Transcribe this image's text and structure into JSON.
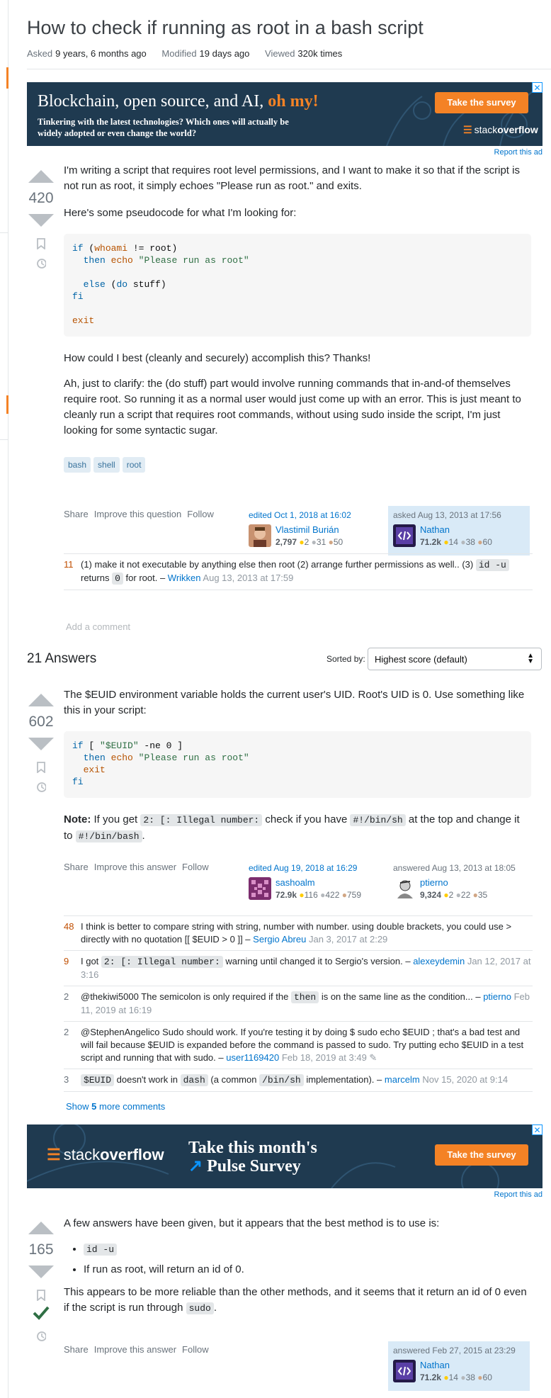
{
  "question": {
    "title": "How to check if running as root in a bash script",
    "asked_label": "Asked",
    "asked": "9 years, 6 months ago",
    "modified_label": "Modified",
    "modified": "19 days ago",
    "viewed_label": "Viewed",
    "viewed": "320k times",
    "score": "420",
    "p1": "I'm writing a script that requires root level permissions, and I want to make it so that if the script is not run as root, it simply echoes \"Please run as root.\" and exits.",
    "p2": "Here's some pseudocode for what I'm looking for:",
    "p3": "How could I best (cleanly and securely) accomplish this? Thanks!",
    "p4": "Ah, just to clarify: the (do stuff) part would involve running commands that in-and-of themselves require root. So running it as a normal user would just come up with an error. This is just meant to cleanly run a script that requires root commands, without using sudo inside the script, I'm just looking for some syntactic sugar.",
    "tags": [
      "bash",
      "shell",
      "root"
    ],
    "actions": [
      "Share",
      "Improve this question",
      "Follow"
    ],
    "edited": {
      "label": "edited Oct 1, 2018 at 16:02",
      "name": "Vlastimil Burián",
      "rep": "2,797",
      "gold": "2",
      "silver": "31",
      "bronze": "50"
    },
    "asked_by": {
      "label": "asked Aug 13, 2013 at 17:56",
      "name": "Nathan",
      "rep": "71.2k",
      "gold": "14",
      "silver": "38",
      "bronze": "60"
    },
    "comment": {
      "score": "11",
      "text_a": "(1) make it not executable by anything else then root (2) arrange further permissions as well.. (3)",
      "code1": "id -u",
      "text_b": "returns",
      "code2": "0",
      "text_c": "for root. –",
      "user": "Wrikken",
      "date": "Aug 13, 2013 at 17:59"
    },
    "add_comment": "Add a comment"
  },
  "ad1": {
    "headline": "Blockchain, open source, and AI,",
    "headline_accent": "oh my!",
    "sub": "Tinkering with the latest technologies? Which ones will actually be widely adopted or even change the world?",
    "button": "Take the survey",
    "logo_a": "stack",
    "logo_b": "overflow",
    "close": "✕"
  },
  "report_ad": "Report this ad",
  "answers_header": {
    "count": "21 Answers",
    "sort_label": "Sorted by:",
    "sort_value": "Highest score (default)"
  },
  "answer1": {
    "score": "602",
    "p1": "The $EUID environment variable holds the current user's UID. Root's UID is 0. Use something like this in your script:",
    "note_label": "Note:",
    "note_a": "If you get",
    "note_code1": "2: [: Illegal number:",
    "note_b": "check if you have",
    "note_code2": "#!/bin/sh",
    "note_c": "at the top and change it to",
    "note_code3": "#!/bin/bash",
    "note_d": ".",
    "actions": [
      "Share",
      "Improve this answer",
      "Follow"
    ],
    "edited": {
      "label": "edited Aug 19, 2018 at 16:29",
      "name": "sashoalm",
      "rep": "72.9k",
      "gold": "116",
      "silver": "422",
      "bronze": "759"
    },
    "answered": {
      "label": "answered Aug 13, 2013 at 18:05",
      "name": "ptierno",
      "rep": "9,324",
      "gold": "2",
      "silver": "22",
      "bronze": "35"
    },
    "comments": [
      {
        "score": "48",
        "text": "I think is better to compare string with string, number with number. using double brackets, you could use > directly with no quotation [[ $EUID > 0 ]] –",
        "user": "Sergio Abreu",
        "date": "Jan 3, 2017 at 2:29"
      },
      {
        "score": "9",
        "text_a": "I got",
        "code": "2: [: Illegal number:",
        "text_b": "warning until changed it to Sergio's version. –",
        "user": "alexeydemin",
        "date": "Jan 12, 2017 at 3:16"
      },
      {
        "score": "2",
        "text_a": "@thekiwi5000 The semicolon is only required if the",
        "code": "then",
        "text_b": "is on the same line as the condition... –",
        "user": "ptierno",
        "date": "Feb 11, 2019 at 16:19"
      },
      {
        "score": "2",
        "text": "@StephenAngelico Sudo should work. If you're testing it by doing $ sudo echo $EUID ; that's a bad test and will fail because $EUID is expanded before the command is passed to sudo. Try putting echo $EUID in a test script and running that with sudo. –",
        "user": "user1169420",
        "date": "Feb 18, 2019 at 3:49"
      },
      {
        "score": "3",
        "code1": "$EUID",
        "text_a": "doesn't work in",
        "code2": "dash",
        "text_b": "(a common",
        "code3": "/bin/sh",
        "text_c": "implementation). –",
        "user": "marcelm",
        "date": "Nov 15, 2020 at 9:14"
      }
    ],
    "show_more_a": "Show",
    "show_more_n": "5",
    "show_more_b": "more comments"
  },
  "ad2": {
    "logo_a": "stack",
    "logo_b": "overflow",
    "headline1": "Take this month's",
    "headline2": "Pulse Survey",
    "button": "Take the survey",
    "close": "✕"
  },
  "answer2": {
    "score": "165",
    "p1": "A few answers have been given, but it appears that the best method is to use is:",
    "li1_code": "id -u",
    "li2": "If run as root, will return an id of 0.",
    "p2_a": "This appears to be more reliable than the other methods, and it seems that it return an id of 0 even if the script is run through",
    "p2_code": "sudo",
    "p2_b": ".",
    "actions": [
      "Share",
      "Improve this answer",
      "Follow"
    ],
    "answered": {
      "label": "answered Feb 27, 2015 at 23:29",
      "name": "Nathan",
      "rep": "71.2k",
      "gold": "14",
      "silver": "38",
      "bronze": "60"
    }
  },
  "icons": {
    "bookmark": "bookmark-icon",
    "history": "history-icon",
    "accepted": "checkmark-icon",
    "pencil": "pencil-icon"
  },
  "colors": {
    "brand_orange": "#f48225",
    "link": "#0074cc",
    "tag_bg": "#e1ecf4",
    "owner_bg": "#d9eaf7",
    "ad_bg": "#1f3a50"
  }
}
